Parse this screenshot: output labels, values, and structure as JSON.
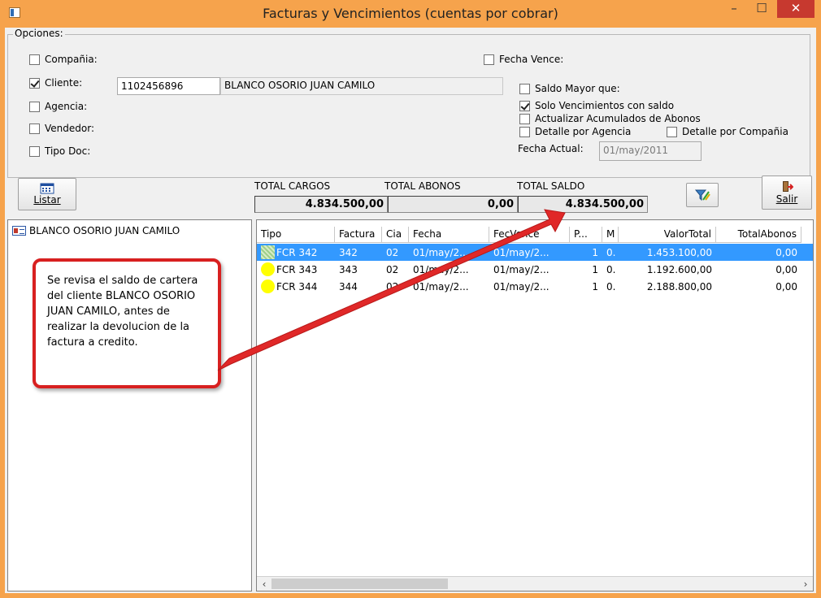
{
  "window": {
    "title": "Facturas y Vencimientos (cuentas por cobrar)",
    "min_glyph": "–",
    "max_glyph": "☐",
    "close_glyph": "✕"
  },
  "options": {
    "legend": "Opciones:",
    "compania": {
      "label": "Compañia:",
      "checked": false
    },
    "cliente": {
      "label": "Cliente:",
      "checked": true,
      "code": "1102456896",
      "name": "BLANCO OSORIO JUAN CAMILO"
    },
    "agencia": {
      "label": "Agencia:",
      "checked": false
    },
    "vendedor": {
      "label": "Vendedor:",
      "checked": false
    },
    "tipo_doc": {
      "label": "Tipo Doc:",
      "checked": false
    },
    "fecha_vence": {
      "label": "Fecha Vence:",
      "checked": false
    },
    "saldo_mayor": {
      "label": "Saldo  Mayor que:",
      "checked": false
    },
    "solo_venc": {
      "label": "Solo Vencimientos con saldo",
      "checked": true
    },
    "actualizar": {
      "label": "Actualizar Acumulados de Abonos",
      "checked": false
    },
    "detalle_agencia": {
      "label": "Detalle por Agencia",
      "checked": false
    },
    "detalle_compania": {
      "label": "Detalle por Compañia",
      "checked": false
    },
    "fecha_actual_label": "Fecha Actual:",
    "fecha_actual_value": "01/may/2011"
  },
  "toolbar": {
    "listar_label": "Listar",
    "salir_label": "Salir"
  },
  "totals": {
    "cargos_label": "TOTAL CARGOS",
    "abonos_label": "TOTAL ABONOS",
    "saldo_label": "TOTAL SALDO",
    "cargos": "4.834.500,00",
    "abonos": "0,00",
    "saldo": "4.834.500,00"
  },
  "tree": {
    "client_name": "BLANCO OSORIO JUAN CAMILO"
  },
  "grid": {
    "headers": [
      "Tipo",
      "Factura",
      "Cia",
      "Fecha",
      "FecVence",
      "P...",
      "M",
      "ValorTotal",
      "TotalAbonos"
    ],
    "rows": [
      {
        "tipo": "FCR 342",
        "factura": "342",
        "cia": "02",
        "fecha": "01/may/2...",
        "vence": "01/may/2...",
        "p": "1",
        "m": "0.",
        "valor": "1.453.100,00",
        "abonos": "0,00",
        "selected": true
      },
      {
        "tipo": "FCR 343",
        "factura": "343",
        "cia": "02",
        "fecha": "01/may/2...",
        "vence": "01/may/2...",
        "p": "1",
        "m": "0.",
        "valor": "1.192.600,00",
        "abonos": "0,00",
        "selected": false
      },
      {
        "tipo": "FCR 344",
        "factura": "344",
        "cia": "02",
        "fecha": "01/may/2...",
        "vence": "01/may/2...",
        "p": "1",
        "m": "0.",
        "valor": "2.188.800,00",
        "abonos": "0,00",
        "selected": false
      }
    ]
  },
  "callout": {
    "text": "Se revisa el saldo de cartera del cliente BLANCO OSORIO JUAN CAMILO, antes de realizar la devolucion de la factura a credito."
  },
  "colors": {
    "title_bar": "#f6a34c",
    "selection": "#3399ff",
    "callout_border": "#d82020",
    "status_dot": "#ffff00"
  }
}
